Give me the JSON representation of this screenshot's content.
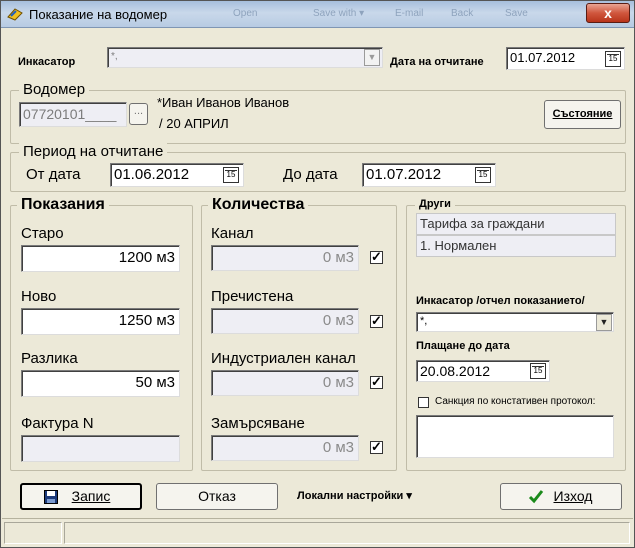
{
  "window": {
    "title": "Показание на водомер",
    "close_label": "x",
    "ghost_items": [
      "Open",
      "Save with ▾",
      "E-mail",
      "Back",
      "Save"
    ]
  },
  "top": {
    "collector_label": "Инкасатор",
    "collector_value": "*,",
    "reading_date_label": "Дата на отчитане",
    "reading_date_value": "01.07.2012"
  },
  "meter": {
    "group_title": "Водомер",
    "number": "07720101____",
    "owner": "*Иван Иванов Иванов",
    "address": "/ 20 АПРИЛ",
    "status_button": "Състояние"
  },
  "period": {
    "group_title": "Период на отчитане",
    "from_label": "От дата",
    "from_value": "01.06.2012",
    "to_label": "До дата",
    "to_value": "01.07.2012"
  },
  "readings": {
    "group_title": "Показания",
    "old_label": "Старо",
    "old_value": "1200 м3",
    "new_label": "Ново",
    "new_value": "1250 м3",
    "diff_label": "Разлика",
    "diff_value": "50 м3",
    "invoice_label": "Фактура N",
    "invoice_value": ""
  },
  "quantities": {
    "group_title": "Количества",
    "items": [
      {
        "label": "Канал",
        "value": "0 м3",
        "checked": true
      },
      {
        "label": "Пречистена",
        "value": "0 м3",
        "checked": true
      },
      {
        "label": "Индустриален канал",
        "value": "0 м3",
        "checked": true
      },
      {
        "label": "Замърсяване",
        "value": "0 м3",
        "checked": true
      }
    ],
    "check_mark": "✓"
  },
  "others": {
    "group_title": "Други",
    "tariff": "Тарифа за граждани",
    "category": "1. Нормален",
    "collector_reported_label": "Инкасатор /отчел показанието/",
    "collector_reported_value": "*,",
    "pay_until_label": "Плащане до дата",
    "pay_until_value": "20.08.2012",
    "sanction_label": "Санкция по констативен протокол:",
    "sanction_checked": false,
    "sanction_text": ""
  },
  "buttons": {
    "save": "Запис",
    "cancel": "Отказ",
    "local_settings": "Локални настройки",
    "exit": "Изход"
  },
  "icons": {
    "calendar_glyph": "15",
    "dropdown_glyph": "▼",
    "ellipsis_glyph": "...",
    "menu_arrow_glyph": "▾"
  }
}
